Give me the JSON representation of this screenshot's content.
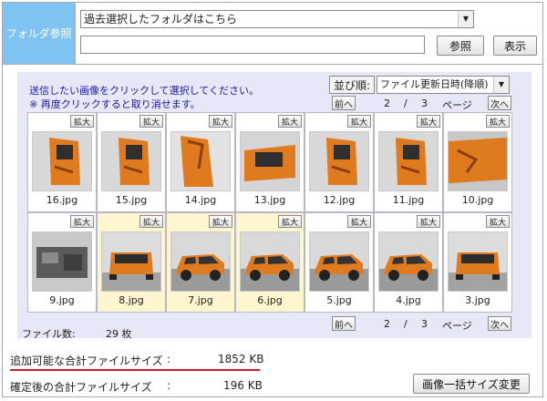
{
  "folder": {
    "label": "フォルダ参照",
    "select_value": "過去選択したフォルダはこちら",
    "path_value": "",
    "browse_label": "参照",
    "show_label": "表示"
  },
  "panel": {
    "note1": "送信したい画像をクリックして選択してください。",
    "note2": "※ 再度クリックすると取り消せます。",
    "sort_label": "並び順:",
    "sort_value": "ファイル更新日時(降順)",
    "prev_label": "前へ",
    "next_label": "次へ",
    "page_current": "2",
    "page_sep": "/",
    "page_total": "3",
    "page_unit": "ページ",
    "zoom_label": "拡大",
    "file_count_label": "ファイル数:",
    "file_count": "29 枚"
  },
  "thumbnails": [
    {
      "name": "16.jpg",
      "selected": false,
      "kind": "door"
    },
    {
      "name": "15.jpg",
      "selected": false,
      "kind": "door"
    },
    {
      "name": "14.jpg",
      "selected": false,
      "kind": "side"
    },
    {
      "name": "13.jpg",
      "selected": false,
      "kind": "trunk"
    },
    {
      "name": "12.jpg",
      "selected": false,
      "kind": "door"
    },
    {
      "name": "11.jpg",
      "selected": false,
      "kind": "door"
    },
    {
      "name": "10.jpg",
      "selected": false,
      "kind": "panel"
    },
    {
      "name": "9.jpg",
      "selected": false,
      "kind": "engine"
    },
    {
      "name": "8.jpg",
      "selected": true,
      "kind": "rear"
    },
    {
      "name": "7.jpg",
      "selected": true,
      "kind": "car"
    },
    {
      "name": "6.jpg",
      "selected": true,
      "kind": "car"
    },
    {
      "name": "5.jpg",
      "selected": false,
      "kind": "car"
    },
    {
      "name": "4.jpg",
      "selected": false,
      "kind": "car"
    },
    {
      "name": "3.jpg",
      "selected": false,
      "kind": "rear"
    }
  ],
  "sizes": {
    "available_label": "追加可能な合計ファイルサイズ",
    "available_colon": ":",
    "available_value": "1852 KB",
    "confirmed_label": "確定後の合計ファイルサイズ",
    "confirmed_colon": ":",
    "confirmed_value": "196 KB",
    "resize_label": "画像一括サイズ変更"
  },
  "colors": {
    "header_blue": "#7ec3f2",
    "panel_bg": "#e6e8f7",
    "selected_bg": "#fff5cf",
    "underline_red": "#d0192b",
    "car_orange": "#e07a1f"
  }
}
